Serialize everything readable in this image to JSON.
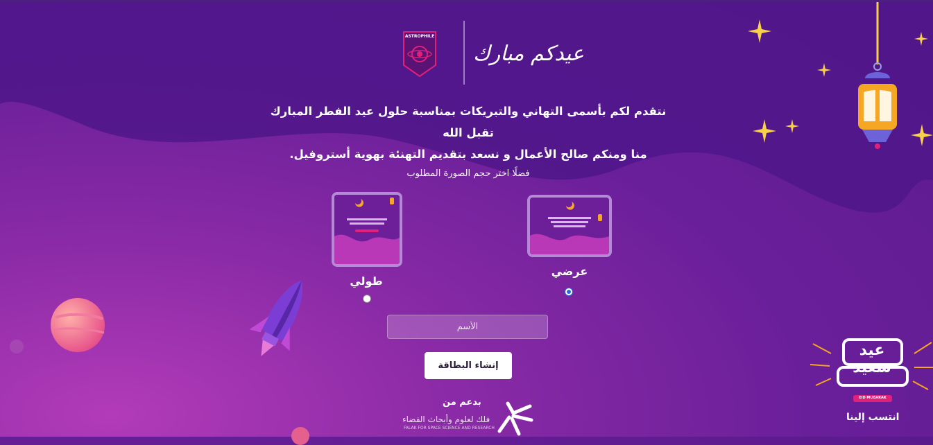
{
  "header": {
    "logo_text": "ASTROPHILE",
    "greeting_calligraphy": "عيدكم مبارك"
  },
  "message": {
    "line1": "نتقدم لكم بأسمى التهاني والتبريكات بمناسبة حلول عيد الفطر المبارك تقبل الله",
    "line2": "منا ومنكم صالح الأعمال و نسعد بتقديم التهنئة بهوية أستروفيل."
  },
  "size_selector": {
    "prompt": "فضلًا اختر حجم الصورة المطلوب",
    "options": [
      {
        "label": "طولي",
        "selected": false
      },
      {
        "label": "عرضي",
        "selected": true
      }
    ]
  },
  "form": {
    "name_value": "",
    "name_placeholder": "الأسم",
    "create_button": "إنشاء البطاقة"
  },
  "sponsor": {
    "title": "بدعم من",
    "name": "فلك لعلوم وأبحاث الفضاء",
    "subtitle": "FALAK FOR SPACE SCIENCE AND RESEARCH"
  },
  "footer": {
    "badge_text": "عيد سعيد",
    "badge_tag": "EID MUBARAK",
    "follow_label": "انتسب إلينا"
  },
  "colors": {
    "background": "#6a1f9a",
    "accent_pink": "#e0217a",
    "star_gold": "#f8d04a",
    "moon_gold": "#f5a623"
  }
}
